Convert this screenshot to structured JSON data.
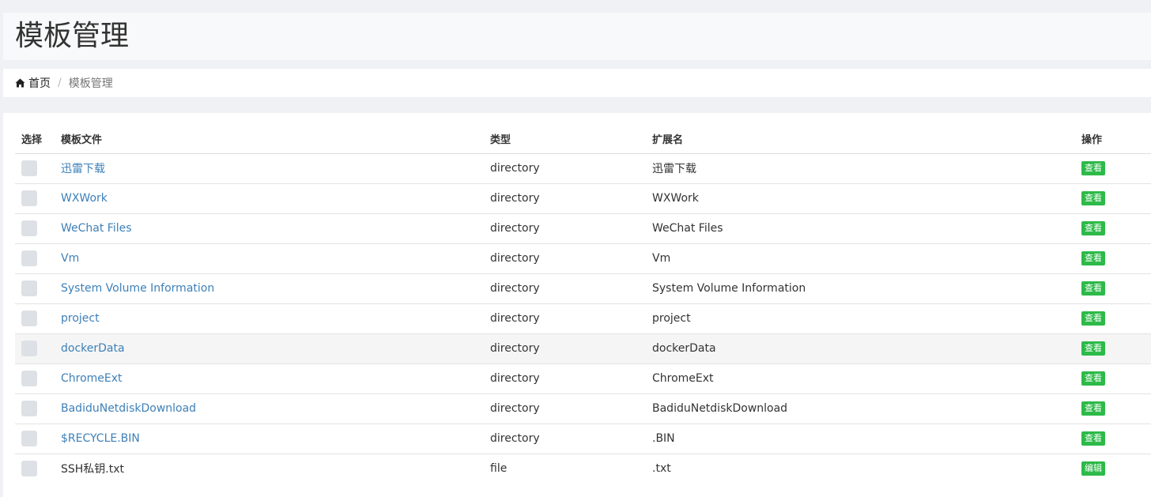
{
  "header": {
    "title": "模板管理"
  },
  "breadcrumb": {
    "home_label": "首页",
    "separator": "/",
    "current_label": "模板管理"
  },
  "table": {
    "columns": [
      "选择",
      "模板文件",
      "类型",
      "扩展名",
      "操作"
    ],
    "rows": [
      {
        "name": "迅雷下载",
        "type": "directory",
        "ext": "迅雷下载",
        "action": "查看",
        "link": true
      },
      {
        "name": "WXWork",
        "type": "directory",
        "ext": "WXWork",
        "action": "查看",
        "link": true
      },
      {
        "name": "WeChat Files",
        "type": "directory",
        "ext": "WeChat Files",
        "action": "查看",
        "link": true
      },
      {
        "name": "Vm",
        "type": "directory",
        "ext": "Vm",
        "action": "查看",
        "link": true
      },
      {
        "name": "System Volume Information",
        "type": "directory",
        "ext": "System Volume Information",
        "action": "查看",
        "link": true
      },
      {
        "name": "project",
        "type": "directory",
        "ext": "project",
        "action": "查看",
        "link": true
      },
      {
        "name": "dockerData",
        "type": "directory",
        "ext": "dockerData",
        "action": "查看",
        "link": true
      },
      {
        "name": "ChromeExt",
        "type": "directory",
        "ext": "ChromeExt",
        "action": "查看",
        "link": true
      },
      {
        "name": "BadiduNetdiskDownload",
        "type": "directory",
        "ext": "BadiduNetdiskDownload",
        "action": "查看",
        "link": true
      },
      {
        "name": "$RECYCLE.BIN",
        "type": "directory",
        "ext": ".BIN",
        "action": "查看",
        "link": true
      },
      {
        "name": "SSH私钥.txt",
        "type": "file",
        "ext": ".txt",
        "action": "编辑",
        "link": false
      }
    ]
  },
  "colors": {
    "link": "#3d80b8",
    "button": "#2dba49",
    "checkbox": "#dde1e5",
    "background": "#eff1f4"
  },
  "icons": {
    "home": "home-icon"
  }
}
